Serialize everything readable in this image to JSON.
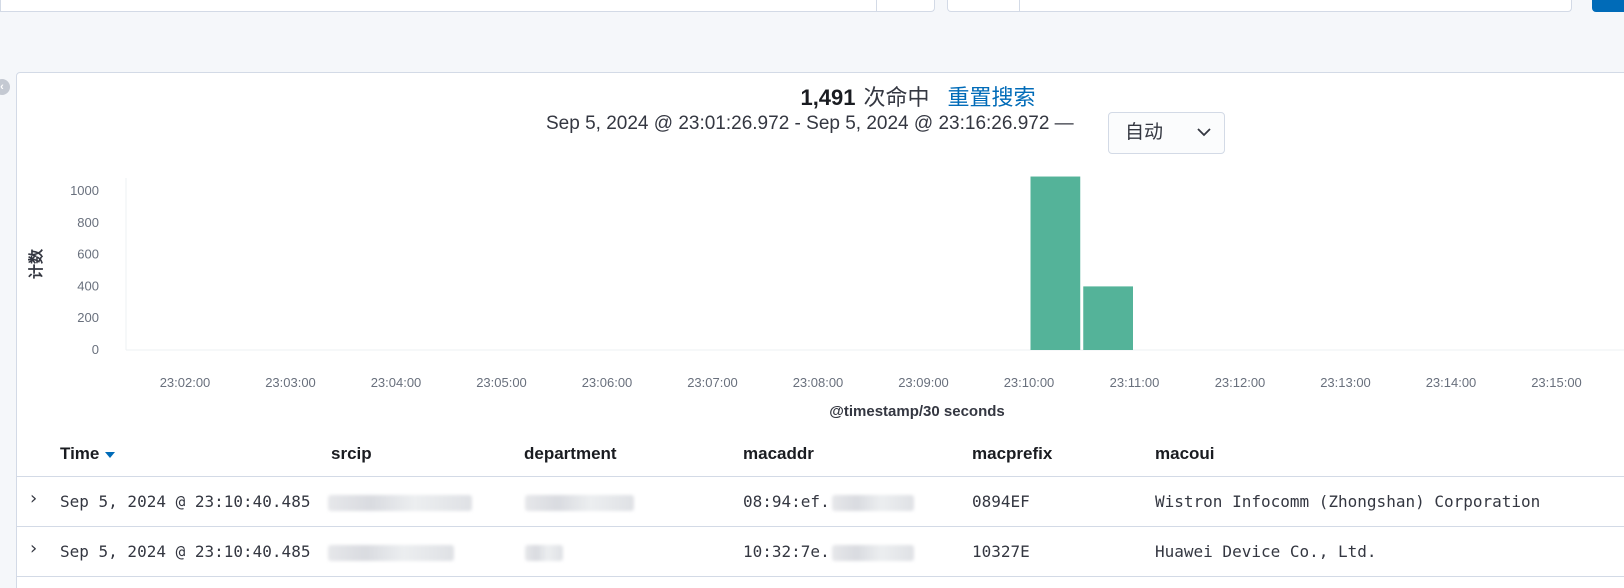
{
  "hits": {
    "count": "1,491",
    "label": "次命中",
    "reset_label": "重置搜索"
  },
  "time_range": {
    "text": "Sep 5, 2024 @ 23:01:26.972 - Sep 5, 2024 @ 23:16:26.972 —"
  },
  "interval_select": {
    "value": "自动",
    "icon": "chevron-down-icon"
  },
  "chart_data": {
    "type": "bar",
    "ylabel": "计数",
    "xlabel": "@timestamp/30 seconds",
    "yticks": [
      0,
      200,
      400,
      600,
      800,
      1000
    ],
    "ylim": [
      0,
      1100
    ],
    "xticks": [
      "23:02:00",
      "23:03:00",
      "23:04:00",
      "23:05:00",
      "23:06:00",
      "23:07:00",
      "23:08:00",
      "23:09:00",
      "23:10:00",
      "23:11:00",
      "23:12:00",
      "23:13:00",
      "23:14:00",
      "23:15:00"
    ],
    "bars": [
      {
        "start": "23:10:00",
        "end": "23:10:30",
        "value": 1091
      },
      {
        "start": "23:10:30",
        "end": "23:11:00",
        "value": 400
      }
    ],
    "bar_color": "#54b399",
    "grid": false
  },
  "table": {
    "columns": [
      {
        "label": "Time",
        "sort_icon": "sort-down-icon"
      },
      {
        "label": "srcip"
      },
      {
        "label": "department"
      },
      {
        "label": "macaddr"
      },
      {
        "label": "macprefix"
      },
      {
        "label": "macoui"
      }
    ],
    "rows": [
      {
        "expand_icon": "›",
        "time": "Sep 5, 2024 @ 23:10:40.485",
        "macaddr": "08:94:ef.",
        "macprefix": "0894EF",
        "macoui": "Wistron Infocomm (Zhongshan) Corporation"
      },
      {
        "expand_icon": "›",
        "time": "Sep 5, 2024 @ 23:10:40.485",
        "macaddr": "10:32:7e.",
        "macprefix": "10327E",
        "macoui": "Huawei Device Co., Ltd."
      }
    ]
  }
}
